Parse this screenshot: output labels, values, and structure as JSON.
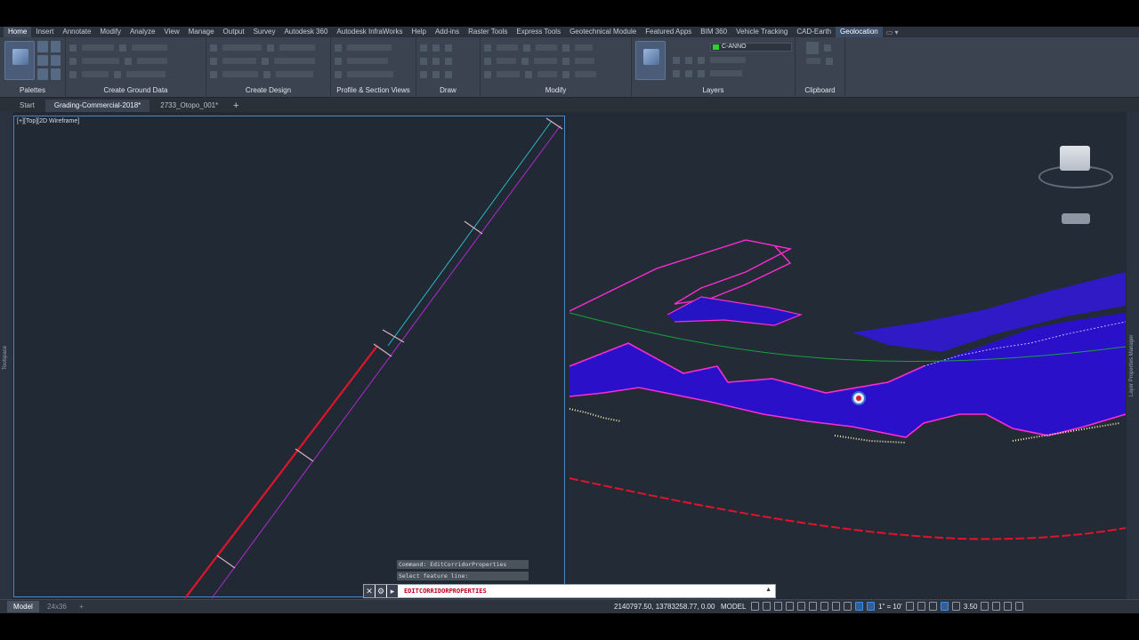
{
  "ribbon": {
    "tabs": [
      "Home",
      "Insert",
      "Annotate",
      "Modify",
      "Analyze",
      "View",
      "Manage",
      "Output",
      "Survey",
      "Autodesk 360",
      "Autodesk InfraWorks",
      "Help",
      "Add-ins",
      "Raster Tools",
      "Express Tools",
      "Geotechnical Module",
      "Featured Apps",
      "BIM 360",
      "Vehicle Tracking",
      "CAD-Earth",
      "Geolocation"
    ],
    "panels": [
      "Palettes",
      "Create Ground Data",
      "Create Design",
      "Profile & Section Views",
      "Draw",
      "Modify",
      "Layers",
      "Clipboard"
    ],
    "current_layer": "C-ANNO"
  },
  "doc_tabs": {
    "items": [
      "Start",
      "Grading-Commercial-2018*",
      "2733_Otopo_001*"
    ]
  },
  "viewport": {
    "left_label": "[+][Top][2D Wireframe]"
  },
  "side": {
    "left_label": "Toolspace",
    "right_label": "Layer Properties Manager"
  },
  "command": {
    "history": [
      "Command: EditCorridorProperties",
      "Select feature line:"
    ],
    "prompt": "EDITCORRIDORPROPERTIES"
  },
  "status": {
    "layout_tabs": [
      "Model",
      "24x36"
    ],
    "coordinates": "2140797.50, 13783258.77, 0.00",
    "mode": "MODEL",
    "scale": "1\" = 10'",
    "value": "3.50"
  },
  "colors": {
    "viewport_bg": "#212935",
    "corridor_fill": "#2a10c8",
    "feature_line": "#ff2bd4",
    "alignment_red": "#e0142a",
    "alignment_cyan": "#2bb6c4"
  }
}
